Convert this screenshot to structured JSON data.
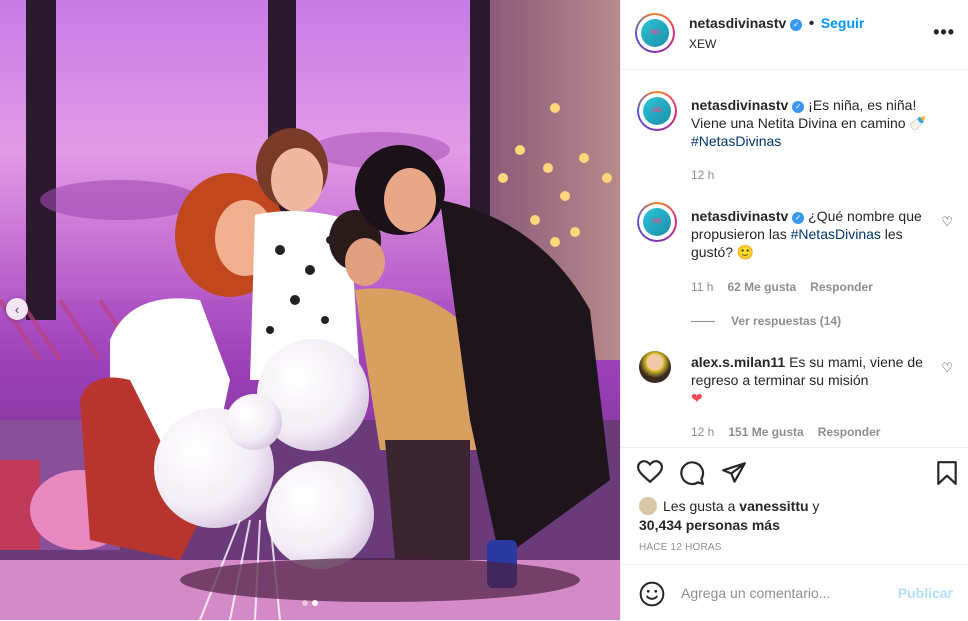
{
  "post": {
    "username": "netasdivinastv",
    "follow_label": "Seguir",
    "location": "XEW",
    "more_label": "•••",
    "avatar_text": "NETAS DIVINAS"
  },
  "caption": {
    "username": "netasdivinastv",
    "text": "¡Es niña, es niña! Viene una Netita Divina en camino 🍼",
    "hashtag": "#NetasDivinas",
    "time": "12 h"
  },
  "comments": [
    {
      "username": "netasdivinastv",
      "text_before": "¿Qué nombre que propusieron las",
      "hashtag": "#NetasDivinas",
      "text_after": "les gustó? 🙂",
      "time": "11 h",
      "likes": "62 Me gusta",
      "reply": "Responder",
      "view_replies": "Ver respuestas (14)"
    },
    {
      "username": "alex.s.milan11",
      "text": "Es su mami, viene de regreso a terminar su misión",
      "emoji": "❤",
      "time": "12 h",
      "likes": "151 Me gusta",
      "reply": "Responder"
    }
  ],
  "likes_line": {
    "prefix": "Les gusta a",
    "user": "vanessittu",
    "connector": "y",
    "count": "30,434 personas más"
  },
  "time_ago": "HACE 12 HORAS",
  "add_comment": {
    "placeholder": "Agrega un comentario...",
    "publish": "Publicar"
  },
  "carousel": {
    "total": 2,
    "active": 2
  },
  "colors": {
    "accent": "#0095f6",
    "verified": "#3897f0",
    "heart": "#ed4956"
  },
  "icons": [
    "heart-icon",
    "comment-icon",
    "share-icon",
    "bookmark-icon",
    "smile-icon",
    "chevron-left-icon",
    "verified-icon",
    "more-icon"
  ]
}
